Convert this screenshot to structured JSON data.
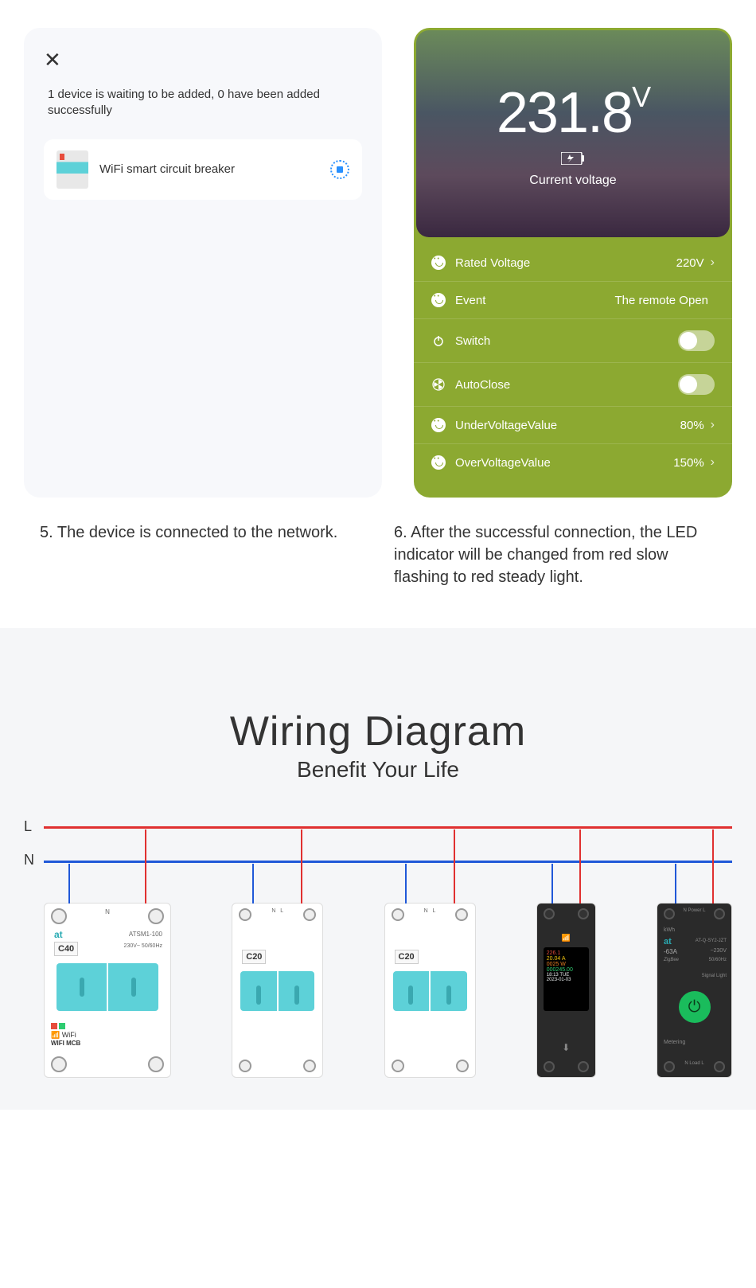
{
  "panel1": {
    "status_text": "1 device is waiting to be added, 0 have been added successfully",
    "device_name": "WiFi smart circuit breaker"
  },
  "panel2": {
    "voltage_value": "231.8",
    "voltage_unit": "V",
    "voltage_label": "Current voltage",
    "rows": {
      "rated_voltage": {
        "label": "Rated Voltage",
        "value": "220V"
      },
      "event": {
        "label": "Event",
        "value": "The remote Open"
      },
      "switch": {
        "label": "Switch"
      },
      "autoclose": {
        "label": "AutoClose"
      },
      "under_voltage": {
        "label": "UnderVoltageValue",
        "value": "80%"
      },
      "over_voltage": {
        "label": "OverVoltageValue",
        "value": "150%"
      }
    }
  },
  "captions": {
    "c5": "5. The device is connected to the network.",
    "c6": "6. After the successful connection, the LED indicator will be changed from red slow flashing to red steady light."
  },
  "wiring": {
    "title": "Wiring Diagram",
    "subtitle": "Benefit Your Life",
    "L": "L",
    "N": "N",
    "breakers": {
      "b1": {
        "logo": "at",
        "model": "ATSM1-100",
        "code": "C40",
        "spec": "230V~  50/60Hz",
        "wifi": "WiFi",
        "mcb": "WIFI MCB"
      },
      "b2": {
        "code": "C20"
      },
      "b3": {
        "code": "C20"
      },
      "b4": {
        "v": "226.1",
        "a": "20.04 A",
        "w": "0025 W",
        "kwh": "000245.00",
        "time": "18:13 TUE",
        "date": "2023-01-03"
      },
      "b5": {
        "logo": "at",
        "model": "AT-Q-SY2-JZT",
        "amp": "-63A",
        "vspec": "~230V",
        "zigbee": "ZigBee",
        "hz": "50/60Hz",
        "meter": "Metering"
      }
    }
  }
}
